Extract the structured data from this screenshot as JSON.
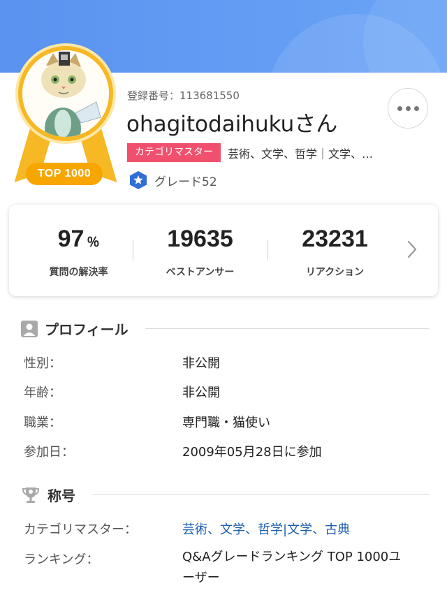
{
  "profile": {
    "registration": "登録番号：113681550",
    "username": "ohagitodaihukuさん",
    "top_badge": "TOP 1000",
    "category_tag": "カテゴリマスター",
    "categories": "芸術、文学、哲学｜文学、古典",
    "grade": "グレード52",
    "avatar_icon": "cat-scholar-avatar",
    "more_icon": "more-dots-icon"
  },
  "stats": {
    "solve_rate": {
      "value": "97",
      "unit": "％",
      "label": "質問の解決率"
    },
    "best_answers": {
      "value": "19635",
      "label": "ベストアンサー"
    },
    "reactions": {
      "value": "23231",
      "label": "リアクション"
    }
  },
  "profile_section": {
    "title": "プロフィール",
    "rows": [
      {
        "label": "性別：",
        "value": "非公開"
      },
      {
        "label": "年齢：",
        "value": "非公開"
      },
      {
        "label": "職業：",
        "value": "専門職・猫使い"
      },
      {
        "label": "参加日：",
        "value": "2009年05月28日に参加"
      }
    ]
  },
  "title_section": {
    "title": "称号",
    "rows": [
      {
        "label": "カテゴリマスター：",
        "value": "芸術、文学、哲学|文学、古典"
      },
      {
        "label": "ランキング：",
        "value": "Q&Aグレードランキング TOP 1000ユーザー"
      }
    ]
  },
  "colors": {
    "header_blue": "#5a93f0",
    "badge_gold": "#f7b825",
    "badge_orange": "#f7a600",
    "category_pink": "#f0506e",
    "link_blue": "#1d5fb0",
    "grade_blue": "#2f6fd6"
  }
}
